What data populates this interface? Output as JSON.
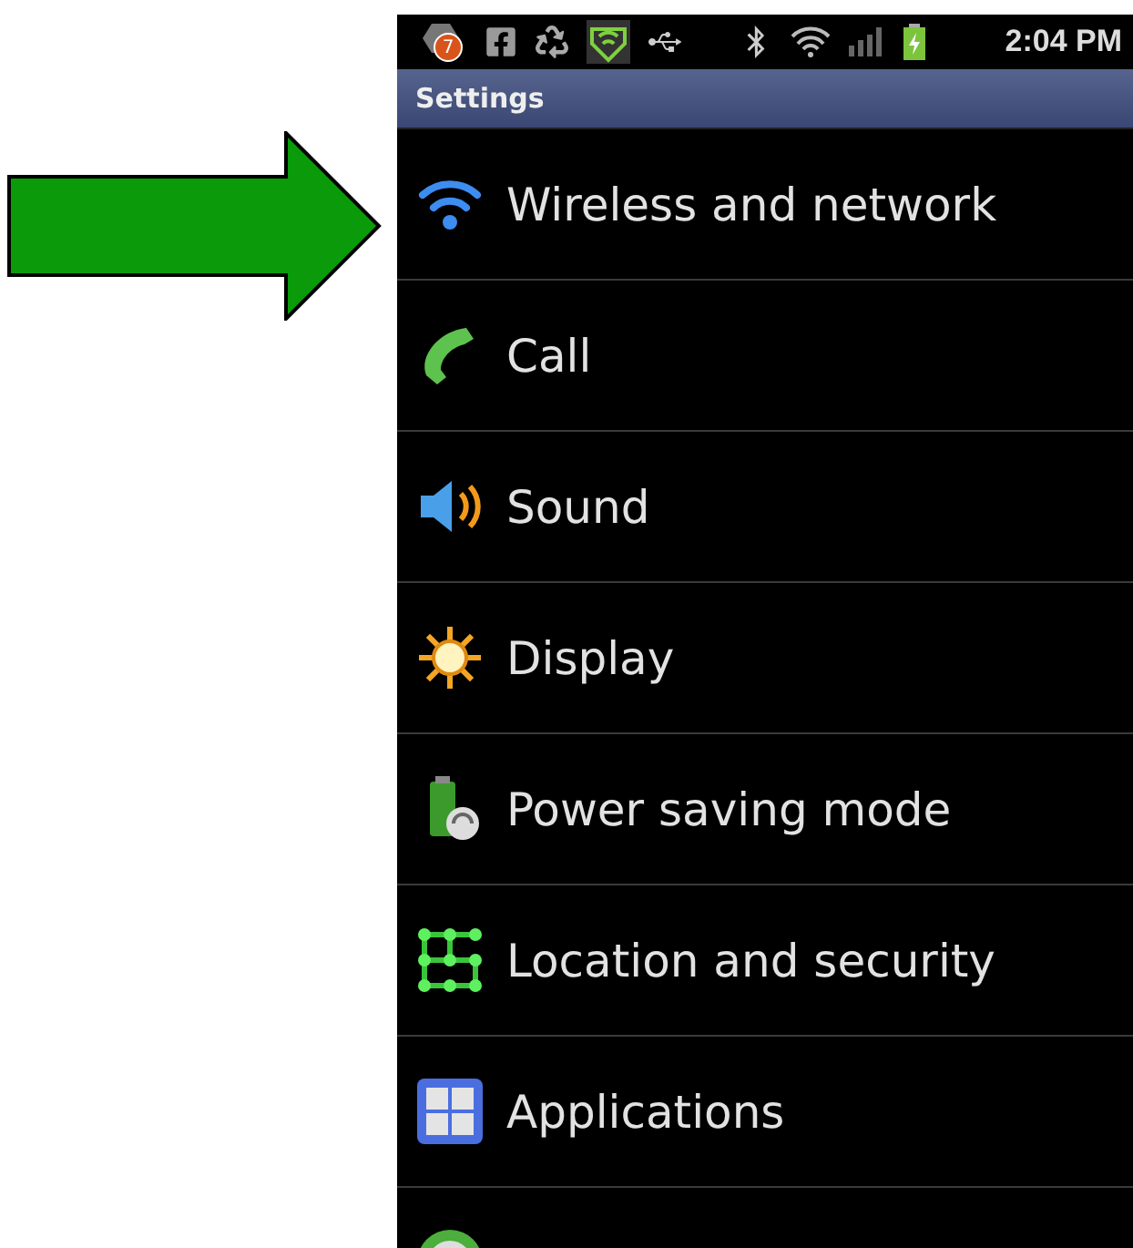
{
  "status_bar": {
    "badge": "7",
    "time": "2:04 PM"
  },
  "title": "Settings",
  "items": [
    {
      "kind": "wifi",
      "label": "Wireless and network"
    },
    {
      "kind": "call",
      "label": "Call"
    },
    {
      "kind": "sound",
      "label": "Sound"
    },
    {
      "kind": "display",
      "label": "Display"
    },
    {
      "kind": "power",
      "label": "Power saving mode"
    },
    {
      "kind": "location",
      "label": "Location and security"
    },
    {
      "kind": "apps",
      "label": "Applications"
    },
    {
      "kind": "sync"
    }
  ]
}
